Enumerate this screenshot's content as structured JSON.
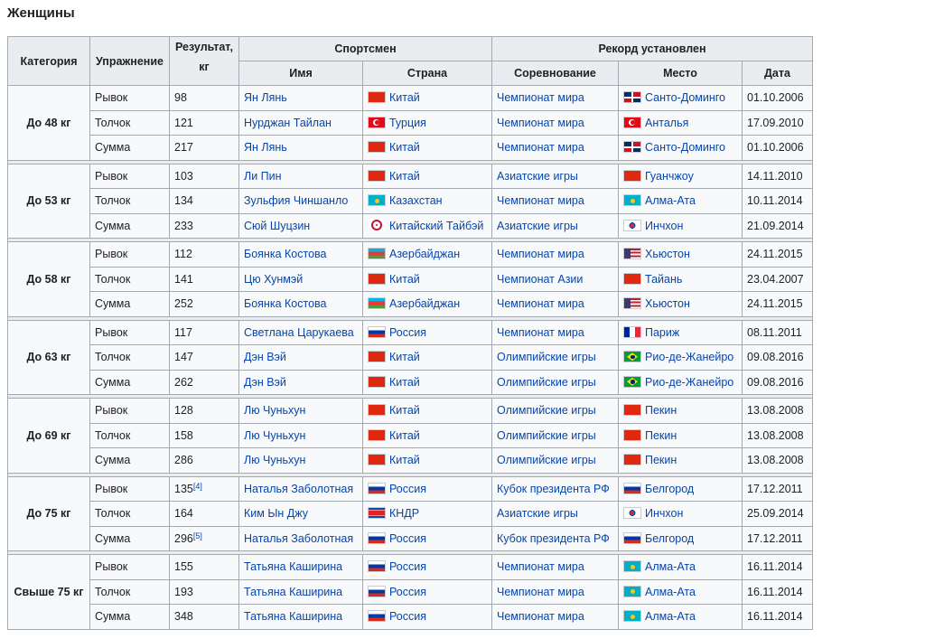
{
  "page_title": "Женщины",
  "headers": {
    "category": "Категория",
    "exercise": "Упражнение",
    "result": "Результат, кг",
    "athlete": "Спортсмен",
    "record": "Рекорд установлен",
    "name": "Имя",
    "country": "Страна",
    "competition": "Соревнование",
    "place": "Место",
    "date": "Дата"
  },
  "flag_colors": {
    "cn": [
      "#de2910"
    ],
    "tr": [
      "#e30a17"
    ],
    "kz": [
      "#00afca"
    ],
    "tw": [
      "#ffffff"
    ],
    "az": [
      "#00b5e2",
      "#ef3340",
      "#509e2f"
    ],
    "ru": [
      "#ffffff",
      "#0039a6",
      "#d52b1e"
    ],
    "kp": [
      "#024fa2",
      "#ed1c27"
    ],
    "do": [
      "#002d62",
      "#ce1126"
    ],
    "kr": [
      "#ffffff",
      "#cd2e3a",
      "#0047a0"
    ],
    "us": [
      "#b22234",
      "#ffffff",
      "#3c3b6e"
    ],
    "fr": [
      "#002395",
      "#ffffff",
      "#ed2939"
    ],
    "br": [
      "#009c3b",
      "#ffdf00",
      "#002776"
    ]
  },
  "groups": [
    {
      "category": "До 48 кг",
      "rows": [
        {
          "exercise": "Рывок",
          "result": "98",
          "ref": "",
          "name": "Ян Лянь",
          "country_flag": "cn",
          "country": "Китай",
          "competition": "Чемпионат мира",
          "place_flag": "do",
          "place": "Санто-Доминго",
          "date": "01.10.2006"
        },
        {
          "exercise": "Толчок",
          "result": "121",
          "ref": "",
          "name": "Нурджан Тайлан",
          "country_flag": "tr",
          "country": "Турция",
          "competition": "Чемпионат мира",
          "place_flag": "tr",
          "place": "Анталья",
          "date": "17.09.2010"
        },
        {
          "exercise": "Сумма",
          "result": "217",
          "ref": "",
          "name": "Ян Лянь",
          "country_flag": "cn",
          "country": "Китай",
          "competition": "Чемпионат мира",
          "place_flag": "do",
          "place": "Санто-Доминго",
          "date": "01.10.2006"
        }
      ]
    },
    {
      "category": "До 53 кг",
      "rows": [
        {
          "exercise": "Рывок",
          "result": "103",
          "ref": "",
          "name": "Ли Пин",
          "country_flag": "cn",
          "country": "Китай",
          "competition": "Азиатские игры",
          "place_flag": "cn",
          "place": "Гуанчжоу",
          "date": "14.11.2010"
        },
        {
          "exercise": "Толчок",
          "result": "134",
          "ref": "",
          "name": "Зульфия Чиншанло",
          "country_flag": "kz",
          "country": "Казахстан",
          "competition": "Чемпионат мира",
          "place_flag": "kz",
          "place": "Алма-Ата",
          "date": "10.11.2014"
        },
        {
          "exercise": "Сумма",
          "result": "233",
          "ref": "",
          "name": "Сюй Шуцзин",
          "country_flag": "tw",
          "country": "Китайский Тайбэй",
          "competition": "Азиатские игры",
          "place_flag": "kr",
          "place": "Инчхон",
          "date": "21.09.2014"
        }
      ]
    },
    {
      "category": "До 58 кг",
      "rows": [
        {
          "exercise": "Рывок",
          "result": "112",
          "ref": "",
          "name": "Боянка Костова",
          "country_flag": "az",
          "country": "Азербайджан",
          "competition": "Чемпионат мира",
          "place_flag": "us",
          "place": "Хьюстон",
          "date": "24.11.2015"
        },
        {
          "exercise": "Толчок",
          "result": "141",
          "ref": "",
          "name": "Цю Хунмэй",
          "country_flag": "cn",
          "country": "Китай",
          "competition": "Чемпионат Азии",
          "place_flag": "cn",
          "place": "Тайань",
          "date": "23.04.2007"
        },
        {
          "exercise": "Сумма",
          "result": "252",
          "ref": "",
          "name": "Боянка Костова",
          "country_flag": "az",
          "country": "Азербайджан",
          "competition": "Чемпионат мира",
          "place_flag": "us",
          "place": "Хьюстон",
          "date": "24.11.2015"
        }
      ]
    },
    {
      "category": "До 63 кг",
      "rows": [
        {
          "exercise": "Рывок",
          "result": "117",
          "ref": "",
          "name": "Светлана Царукаева",
          "country_flag": "ru",
          "country": "Россия",
          "competition": "Чемпионат мира",
          "place_flag": "fr",
          "place": "Париж",
          "date": "08.11.2011"
        },
        {
          "exercise": "Толчок",
          "result": "147",
          "ref": "",
          "name": "Дэн Вэй",
          "country_flag": "cn",
          "country": "Китай",
          "competition": "Олимпийские игры",
          "place_flag": "br",
          "place": "Рио-де-Жанейро",
          "date": "09.08.2016"
        },
        {
          "exercise": "Сумма",
          "result": "262",
          "ref": "",
          "name": "Дэн Вэй",
          "country_flag": "cn",
          "country": "Китай",
          "competition": "Олимпийские игры",
          "place_flag": "br",
          "place": "Рио-де-Жанейро",
          "date": "09.08.2016"
        }
      ]
    },
    {
      "category": "До 69 кг",
      "rows": [
        {
          "exercise": "Рывок",
          "result": "128",
          "ref": "",
          "name": "Лю Чуньхун",
          "country_flag": "cn",
          "country": "Китай",
          "competition": "Олимпийские игры",
          "place_flag": "cn",
          "place": "Пекин",
          "date": "13.08.2008"
        },
        {
          "exercise": "Толчок",
          "result": "158",
          "ref": "",
          "name": "Лю Чуньхун",
          "country_flag": "cn",
          "country": "Китай",
          "competition": "Олимпийские игры",
          "place_flag": "cn",
          "place": "Пекин",
          "date": "13.08.2008"
        },
        {
          "exercise": "Сумма",
          "result": "286",
          "ref": "",
          "name": "Лю Чуньхун",
          "country_flag": "cn",
          "country": "Китай",
          "competition": "Олимпийские игры",
          "place_flag": "cn",
          "place": "Пекин",
          "date": "13.08.2008"
        }
      ]
    },
    {
      "category": "До 75 кг",
      "rows": [
        {
          "exercise": "Рывок",
          "result": "135",
          "ref": "[4]",
          "name": "Наталья Заболотная",
          "country_flag": "ru",
          "country": "Россия",
          "competition": "Кубок президента РФ",
          "place_flag": "ru",
          "place": "Белгород",
          "date": "17.12.2011"
        },
        {
          "exercise": "Толчок",
          "result": "164",
          "ref": "",
          "name": "Ким Ын Джу",
          "country_flag": "kp",
          "country": "КНДР",
          "competition": "Азиатские игры",
          "place_flag": "kr",
          "place": "Инчхон",
          "date": "25.09.2014"
        },
        {
          "exercise": "Сумма",
          "result": "296",
          "ref": "[5]",
          "name": "Наталья Заболотная",
          "country_flag": "ru",
          "country": "Россия",
          "competition": "Кубок президента РФ",
          "place_flag": "ru",
          "place": "Белгород",
          "date": "17.12.2011"
        }
      ]
    },
    {
      "category": "Свыше 75 кг",
      "rows": [
        {
          "exercise": "Рывок",
          "result": "155",
          "ref": "",
          "name": "Татьяна Каширина",
          "country_flag": "ru",
          "country": "Россия",
          "competition": "Чемпионат мира",
          "place_flag": "kz",
          "place": "Алма-Ата",
          "date": "16.11.2014"
        },
        {
          "exercise": "Толчок",
          "result": "193",
          "ref": "",
          "name": "Татьяна Каширина",
          "country_flag": "ru",
          "country": "Россия",
          "competition": "Чемпионат мира",
          "place_flag": "kz",
          "place": "Алма-Ата",
          "date": "16.11.2014"
        },
        {
          "exercise": "Сумма",
          "result": "348",
          "ref": "",
          "name": "Татьяна Каширина",
          "country_flag": "ru",
          "country": "Россия",
          "competition": "Чемпионат мира",
          "place_flag": "kz",
          "place": "Алма-Ата",
          "date": "16.11.2014"
        }
      ]
    }
  ]
}
